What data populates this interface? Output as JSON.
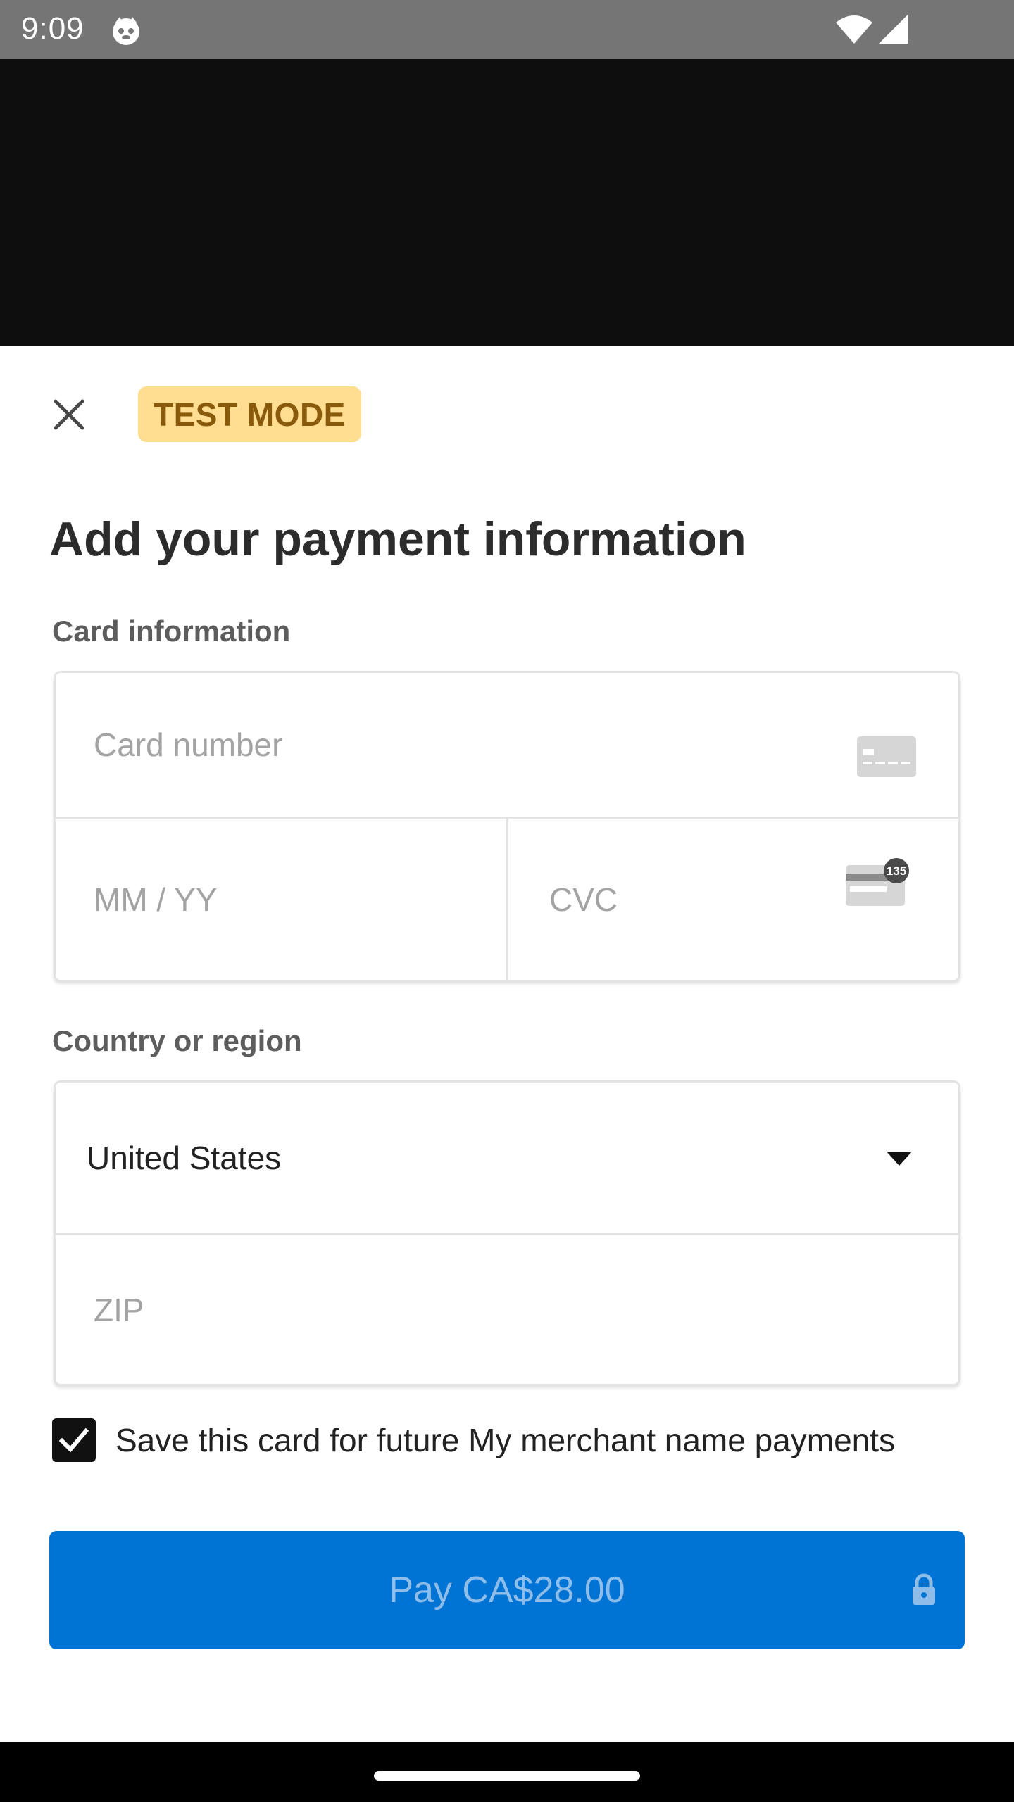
{
  "status_bar": {
    "time": "9:09",
    "icons": [
      "app-notification-icon",
      "wifi-icon",
      "cell-signal-icon"
    ]
  },
  "sheet": {
    "close_icon": "close-icon",
    "badge": "TEST MODE",
    "title": "Add your payment information",
    "card_section": {
      "label": "Card information",
      "card_number_placeholder": "Card number",
      "expiry_placeholder": "MM / YY",
      "cvc_placeholder": "CVC",
      "cvc_icon_text": "135"
    },
    "country_section": {
      "label": "Country or region",
      "selected_country": "United States",
      "zip_placeholder": "ZIP"
    },
    "save_card": {
      "checked": true,
      "label": "Save this card for future My merchant name payments"
    },
    "pay_button": {
      "label": "Pay CA$28.00",
      "icon": "lock-icon"
    }
  },
  "colors": {
    "accent": "#0074d4",
    "badge_bg": "#ffde92",
    "badge_text": "#8a5a0c",
    "status_bar": "#757575"
  }
}
